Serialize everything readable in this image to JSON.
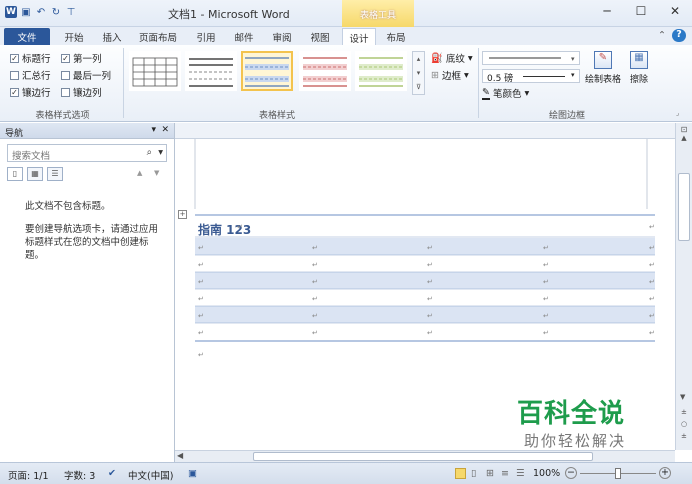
{
  "titlebar": {
    "title": "文档1 - Microsoft Word",
    "context_tab": "表格工具",
    "minimize": "─",
    "maximize": "☐",
    "close": "✕"
  },
  "tabs": [
    "文件",
    "开始",
    "插入",
    "页面布局",
    "引用",
    "邮件",
    "审阅",
    "视图",
    "设计",
    "布局"
  ],
  "ribbon": {
    "options": [
      "标题行",
      "第一列",
      "汇总行",
      "最后一列",
      "镶边行",
      "镶边列"
    ],
    "options_checked": [
      true,
      true,
      false,
      false,
      true,
      false
    ],
    "group_options": "表格样式选项",
    "group_styles": "表格样式",
    "group_borders": "绘图边框",
    "shading": "底纹",
    "borders": "边框",
    "pen_weight": "0.5 磅",
    "pen_color": "笔颜色",
    "draw_table": "绘制表格",
    "eraser": "擦除"
  },
  "nav": {
    "title": "导航",
    "search_placeholder": "搜索文档",
    "msg1": "此文档不包含标题。",
    "msg2": "要创建导航选项卡，请通过应用标题样式在您的文档中创建标题。"
  },
  "doc": {
    "heading": "指南 123"
  },
  "status": {
    "page": "页面: 1/1",
    "words": "字数: 3",
    "lang": "中文(中国)",
    "zoom": "100%"
  },
  "watermark": {
    "title": "百科全说",
    "sub": "助你轻松解决"
  },
  "colors": {
    "accent": "#2b579a",
    "band": "#dbe4f3",
    "context": "#f6d86a",
    "brand": "#1e9c4c"
  }
}
